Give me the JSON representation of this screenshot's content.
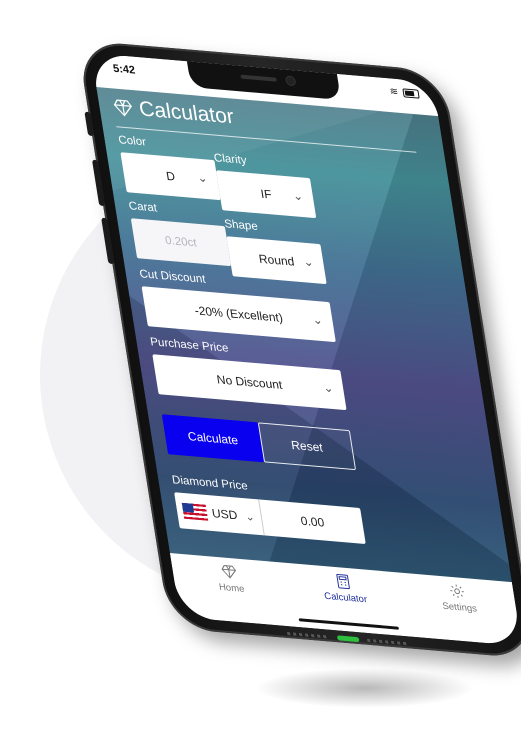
{
  "status_bar": {
    "time": "5:42"
  },
  "app": {
    "title": "Calculator"
  },
  "form": {
    "color": {
      "label": "Color",
      "value": "D"
    },
    "clarity": {
      "label": "Clarity",
      "value": "IF"
    },
    "carat": {
      "label": "Carat",
      "placeholder": "0.20ct"
    },
    "shape": {
      "label": "Shape",
      "value": "Round"
    },
    "cut_discount": {
      "label": "Cut Discount",
      "value": "-20% (Excellent)"
    },
    "purchase_price": {
      "label": "Purchase Price",
      "value": "No Discount"
    }
  },
  "actions": {
    "calculate": "Calculate",
    "reset": "Reset"
  },
  "diamond_price": {
    "label": "Diamond Price",
    "currency": "USD",
    "value": "0.00"
  },
  "tabs": [
    {
      "label": "Home",
      "icon": "diamond-icon",
      "active": false
    },
    {
      "label": "Calculator",
      "icon": "calculator-icon",
      "active": true
    },
    {
      "label": "Settings",
      "icon": "gear-icon",
      "active": false
    }
  ],
  "colors": {
    "accent": "#0a00f0",
    "active_tab": "#1f2f9a",
    "tab_inactive": "#777777"
  }
}
